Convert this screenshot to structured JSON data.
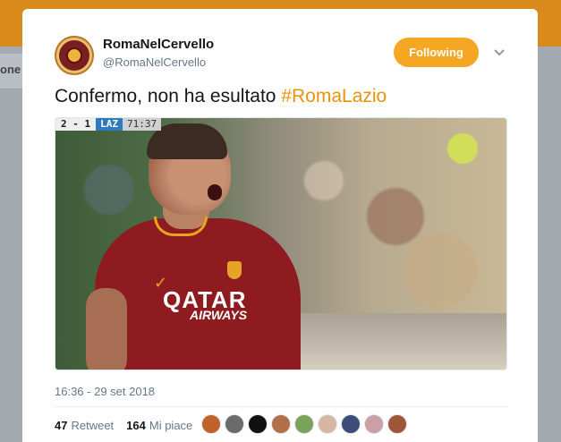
{
  "background": {
    "tab_fragment": "one"
  },
  "tweet": {
    "user_name": "RomaNelCervello",
    "user_handle": "@RomaNelCervello",
    "follow_label": "Following",
    "text": "Confermo, non ha esultato ",
    "hashtag": "#RomaLazio",
    "timestamp": "16:36 - 29 set 2018",
    "retweets_count": "47",
    "retweets_label": "Retweet",
    "likes_count": "164",
    "likes_label": "Mi piace",
    "liker_avatars": [
      {
        "color": "#c0622a"
      },
      {
        "color": "#6b6b6b"
      },
      {
        "color": "#111111"
      },
      {
        "color": "#b0704a"
      },
      {
        "color": "#7aa25b"
      },
      {
        "color": "#d7b7a3"
      },
      {
        "color": "#3c4d7a"
      },
      {
        "color": "#c9a0a6"
      },
      {
        "color": "#a0553a"
      }
    ]
  },
  "media": {
    "scorebug": {
      "score": "2 - 1",
      "team": "LAZ",
      "clock": "71:37"
    },
    "sponsor": "QATAR",
    "sponsor_sub": "AIRWAYS"
  },
  "colors": {
    "accent": "#f5a623",
    "hashtag": "#e8930c",
    "topbar": "#d98a1a"
  }
}
